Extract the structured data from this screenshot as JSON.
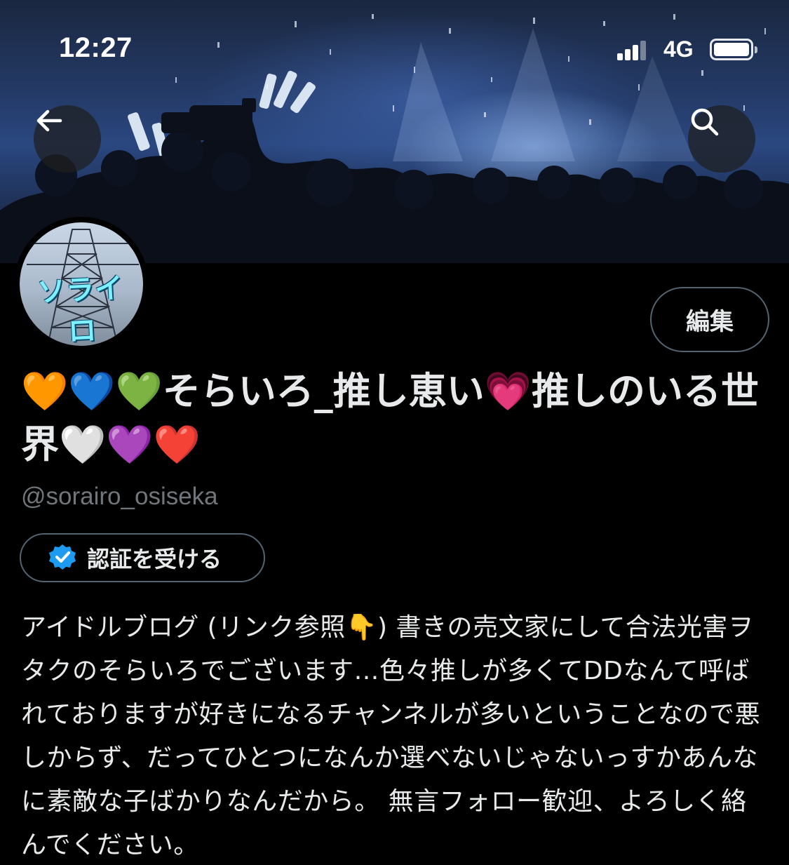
{
  "status_bar": {
    "time": "12:27",
    "network": "4G",
    "signal_bars_active": 3,
    "signal_bars_total": 4
  },
  "banner": {
    "back_icon": "arrow-left-icon",
    "search_icon": "search-icon"
  },
  "avatar": {
    "text": "ソライロ"
  },
  "profile": {
    "edit_label": "編集",
    "display_name": "🧡💙💚そらいろ_推し恵い💗推しのいる世界🤍💜❤️",
    "handle": "@sorairo_osiseka",
    "verify_label": "認証を受ける",
    "bio": "アイドルブログ (リンク参照👇) 書きの売文家にして合法光害ヲタクのそらいろでございます…色々推しが多くてDDなんて呼ばれておりますが好きになるチャンネルが多いということなので悪しからず、だってひとつになんか選べないじゃないっすかあんなに素敵な子ばかりなんだから。 無言フォロー歓迎、よろしく絡んでください。"
  },
  "colors": {
    "background": "#000000",
    "text_primary": "#e7e9ea",
    "text_secondary": "#71767b",
    "border": "#536471",
    "verified_blue": "#1d9bf0"
  }
}
